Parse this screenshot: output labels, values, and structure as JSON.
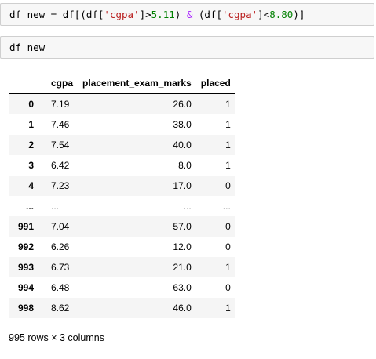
{
  "cells": [
    {
      "tokens": [
        {
          "text": "df_new = df[(df[",
          "kind": "plain"
        },
        {
          "text": "'cgpa'",
          "kind": "str"
        },
        {
          "text": "]>",
          "kind": "plain"
        },
        {
          "text": "5.11",
          "kind": "num"
        },
        {
          "text": ") ",
          "kind": "plain"
        },
        {
          "text": "&",
          "kind": "op"
        },
        {
          "text": " (df[",
          "kind": "plain"
        },
        {
          "text": "'cgpa'",
          "kind": "str"
        },
        {
          "text": "]<",
          "kind": "plain"
        },
        {
          "text": "8.80",
          "kind": "num"
        },
        {
          "text": ")]",
          "kind": "plain"
        }
      ]
    },
    {
      "tokens": [
        {
          "text": "df_new",
          "kind": "plain"
        }
      ]
    }
  ],
  "dataframe": {
    "columns": [
      "cgpa",
      "placement_exam_marks",
      "placed"
    ],
    "rows": [
      {
        "index": "0",
        "values": [
          "7.19",
          "26.0",
          "1"
        ]
      },
      {
        "index": "1",
        "values": [
          "7.46",
          "38.0",
          "1"
        ]
      },
      {
        "index": "2",
        "values": [
          "7.54",
          "40.0",
          "1"
        ]
      },
      {
        "index": "3",
        "values": [
          "6.42",
          "8.0",
          "1"
        ]
      },
      {
        "index": "4",
        "values": [
          "7.23",
          "17.0",
          "0"
        ]
      },
      {
        "index": "...",
        "values": [
          "...",
          "...",
          "..."
        ]
      },
      {
        "index": "991",
        "values": [
          "7.04",
          "57.0",
          "0"
        ]
      },
      {
        "index": "992",
        "values": [
          "6.26",
          "12.0",
          "0"
        ]
      },
      {
        "index": "993",
        "values": [
          "6.73",
          "21.0",
          "1"
        ]
      },
      {
        "index": "994",
        "values": [
          "6.48",
          "63.0",
          "0"
        ]
      },
      {
        "index": "998",
        "values": [
          "8.62",
          "46.0",
          "1"
        ]
      }
    ],
    "shape_text": "995 rows × 3 columns"
  },
  "colors": {
    "string": "#ba2121",
    "number": "#008000",
    "operator": "#aa22ff",
    "cell_background": "#f7f7f7",
    "cell_border": "#cfcfcf",
    "row_stripe": "#f5f5f5"
  }
}
